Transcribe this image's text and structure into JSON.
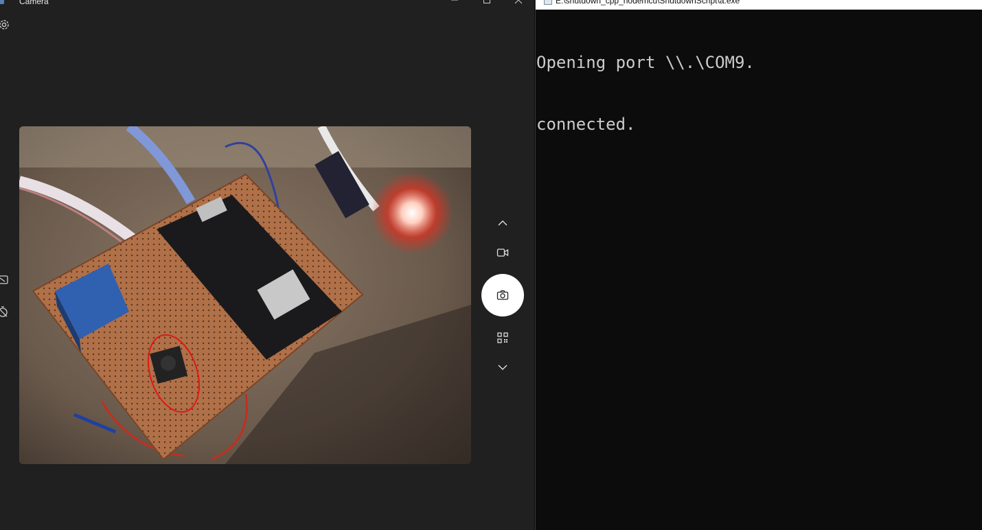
{
  "camera": {
    "title": "Camera",
    "icons": {
      "settings": "gear-icon",
      "hdr": "hdr-icon",
      "timer": "timer-icon",
      "up": "chevron-up-icon",
      "video": "video-camera-icon",
      "photo": "camera-icon",
      "qr": "qr-code-icon",
      "down": "chevron-down-icon"
    }
  },
  "console": {
    "title": "E:\\shutdown_cpp_nodemcu\\ShutdownScript\\a.exe",
    "lines": [
      "Opening port \\\\.\\COM9.",
      "connected."
    ]
  },
  "colors": {
    "camera_bg": "#202020",
    "console_bg": "#0c0c0c",
    "console_text": "#cccccc",
    "shutter": "#ffffff"
  }
}
